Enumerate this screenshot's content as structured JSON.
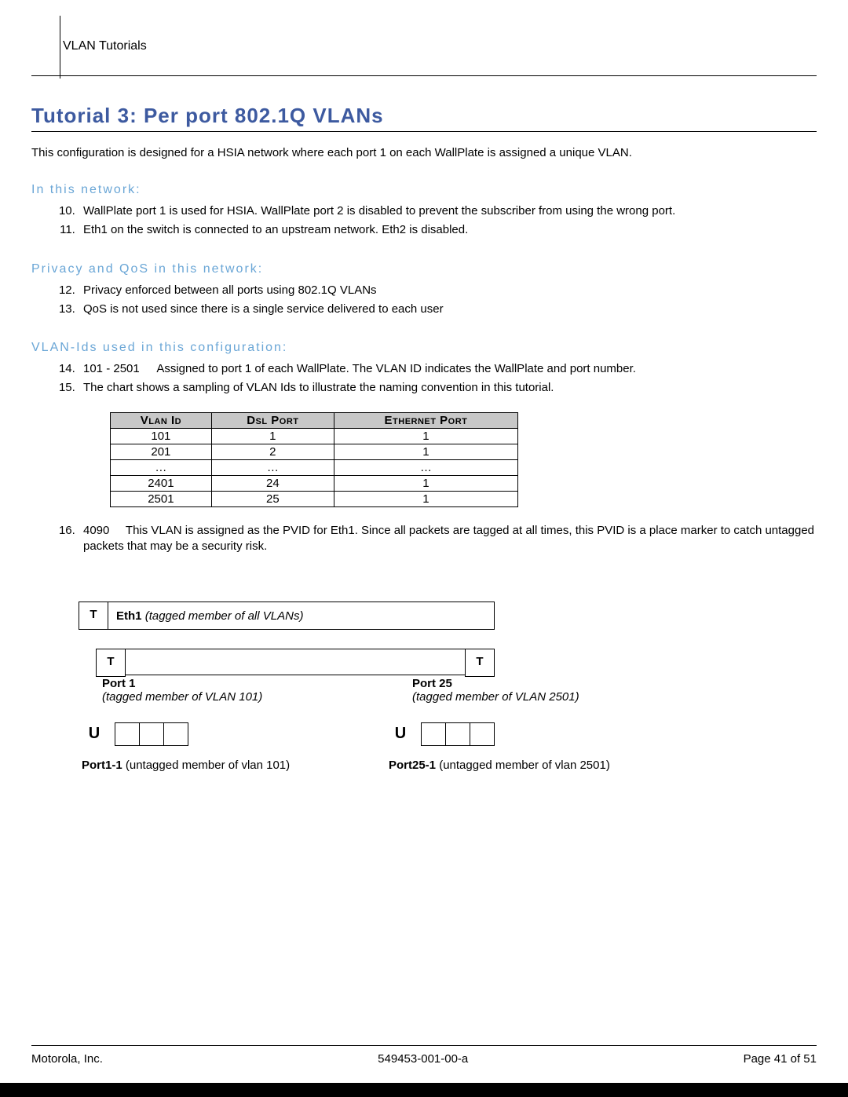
{
  "header": {
    "breadcrumb": "VLAN Tutorials"
  },
  "title": "Tutorial 3:  Per port 802.1Q VLANs",
  "intro": "This configuration is designed for a HSIA network where each port 1 on each WallPlate is assigned a unique VLAN.",
  "sections": {
    "in_network": {
      "heading": "In this network:",
      "items": [
        "WallPlate port 1 is used for HSIA.  WallPlate port 2 is disabled to prevent the subscriber from using the wrong port.",
        "Eth1 on the switch is connected to an upstream network.  Eth2 is disabled."
      ],
      "start": 10
    },
    "privacy_qos": {
      "heading": "Privacy and QoS in this network:",
      "items": [
        "Privacy enforced between all ports using 802.1Q VLANs",
        "QoS is not used since there is a single service delivered to each user"
      ],
      "start": 12
    },
    "vlan_ids": {
      "heading": "VLAN-Ids used in this configuration:",
      "item14_key": "101 - 2501",
      "item14_text": "Assigned to port 1 of each WallPlate.  The VLAN ID indicates the WallPlate and port number.",
      "item15_text": "The chart shows a sampling of VLAN Ids to illustrate the naming convention in this tutorial.",
      "item16_key": "4090",
      "item16_text": "This VLAN is assigned as the PVID for Eth1.  Since all packets are tagged at all times, this PVID is a place marker to catch untagged packets that may be a security risk.",
      "start": 14
    }
  },
  "table": {
    "headers": [
      "Vlan Id",
      "Dsl Port",
      "Ethernet Port"
    ],
    "rows": [
      [
        "101",
        "1",
        "1"
      ],
      [
        "201",
        "2",
        "1"
      ],
      [
        "…",
        "…",
        "…"
      ],
      [
        "2401",
        "24",
        "1"
      ],
      [
        "2501",
        "25",
        "1"
      ]
    ]
  },
  "diagram": {
    "T": "T",
    "U": "U",
    "eth1_bold": "Eth1",
    "eth1_ital": "tagged member of all VLANs)",
    "eth1_open": " (",
    "port1_bold": "Port 1",
    "port1_ital": "(tagged member of VLAN 101)",
    "port25_bold": "Port 25",
    "port25_ital": "(tagged member of VLAN 2501)",
    "u1_bold": "Port1-1",
    "u1_text": "  (untagged member of vlan 101)",
    "u25_bold": "Port25-1",
    "u25_text": "  (untagged member of vlan 2501)"
  },
  "footer": {
    "left": "Motorola, Inc.",
    "center": "549453-001-00-a",
    "right": "Page 41 of 51"
  }
}
